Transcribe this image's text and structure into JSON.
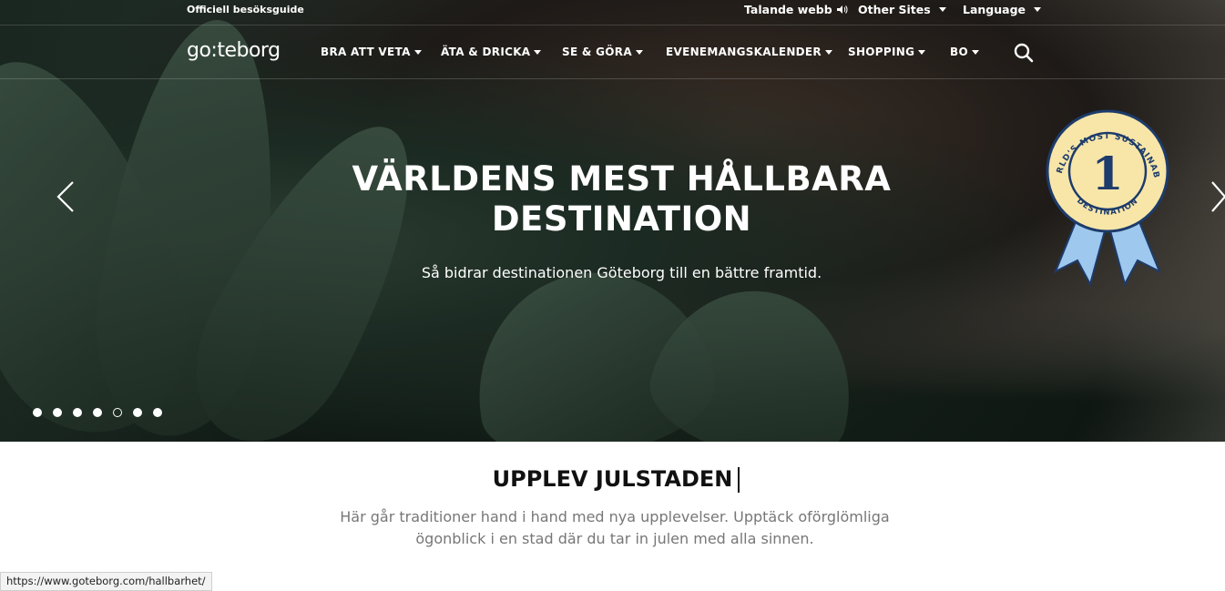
{
  "topbar": {
    "official": "Officiell besöksguide",
    "talande": "Talande webb",
    "other_sites": "Other Sites",
    "language": "Language"
  },
  "nav": {
    "logo": "go:teborg",
    "items": [
      "BRA ATT VETA",
      "ÄTA & DRICKA",
      "SE & GÖRA",
      "EVENEMANGSKALENDER",
      "SHOPPING",
      "BO"
    ]
  },
  "hero": {
    "headline_1": "VÄRLDENS MEST HÅLLBARA",
    "headline_2": "DESTINATION",
    "subline": "Så bidrar destinationen Göteborg till en bättre framtid.",
    "slides_total": 7,
    "active_slide": 5,
    "badge": {
      "top_text": "WORLD'S MOST SUSTAINABLE",
      "number": "1",
      "bottom_text": "DESTINATION"
    }
  },
  "section": {
    "title": "UPPLEV JULSTADEN",
    "text": "Här går traditioner hand i hand med nya upplevelser. Upptäck oförglömliga ögonblick i en stad där du tar in julen med alla sinnen."
  },
  "status": {
    "url": "https://www.goteborg.com/hallbarhet/"
  },
  "colors": {
    "badge_fill": "#f7e6a8",
    "badge_navy": "#1d3b6b",
    "ribbon": "#9ec8ee"
  }
}
